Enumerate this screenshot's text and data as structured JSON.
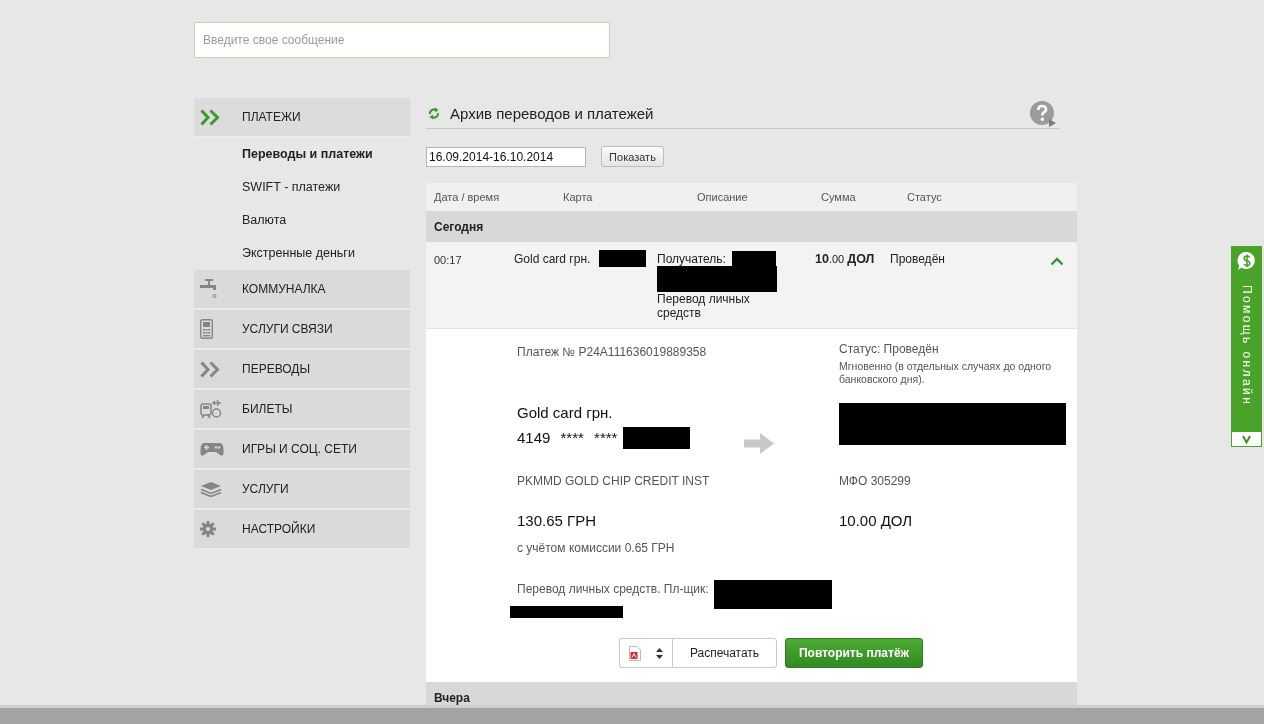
{
  "search": {
    "placeholder": "Введите свое сообщение"
  },
  "sidebar": {
    "items": [
      {
        "label": "ПЛАТЕЖИ",
        "selected": true,
        "children": [
          {
            "label": "Переводы и платежи",
            "selected": true
          },
          {
            "label": "SWIFT - платежи",
            "selected": false
          },
          {
            "label": "Валюта",
            "selected": false
          },
          {
            "label": "Экстренные деньги",
            "selected": false
          }
        ]
      },
      {
        "label": "КОММУНАЛКА",
        "selected": false
      },
      {
        "label": "УСЛУГИ СВЯЗИ",
        "selected": false
      },
      {
        "label": "ПЕРЕВОДЫ",
        "selected": false
      },
      {
        "label": "БИЛЕТЫ",
        "selected": false
      },
      {
        "label": "ИГРЫ И СОЦ. СЕТИ",
        "selected": false
      },
      {
        "label": "УСЛУГИ",
        "selected": false
      },
      {
        "label": "НАСТРОЙКИ",
        "selected": false
      }
    ]
  },
  "archive": {
    "title": "Архив переводов и платежей",
    "date_range": "16.09.2014-16.10.2014",
    "show_button": "Показать",
    "table": {
      "columns": [
        "Дата / время",
        "Карта",
        "Описание",
        "Сумма",
        "Статус"
      ],
      "groups": [
        {
          "label": "Сегодня",
          "rows": [
            {
              "time": "00:17",
              "card": "Gold card грн.",
              "card_redacted": true,
              "recipient_label": "Получатель:",
              "recipient_redacted": true,
              "description": "Перевод личных средств",
              "amount": "**10**.00 **ДОЛ**",
              "status": "Проведён",
              "expanded": true,
              "details": {
                "payment_number": "Платеж № P24A111636019889358",
                "status": "Статус: Проведён",
                "status_note": "Мгновенно (в отдельных случаях до одного банковского дня).",
                "source_card": "Gold card грн.",
                "source_number": "4149 **** ****",
                "source_redacted": true,
                "target_redacted": true,
                "source_bank": "PKMMD GOLD CHIP CREDIT INST",
                "target_bank": "МФО 305299",
                "debit_amount": "130.65 ГРН",
                "credit_amount": "10.00 ДОЛ",
                "commission": "с учётом комиссии 0.65 ГРН",
                "purpose": "Перевод личных средств. Пл-щик:",
                "purpose_redacted": true,
                "print_button": "Распечатать",
                "repeat_button": "Повторить платёж"
              }
            }
          ]
        },
        {
          "label": "Вчера"
        }
      ]
    }
  },
  "help_tab": {
    "label": "Помощь онлайн"
  }
}
